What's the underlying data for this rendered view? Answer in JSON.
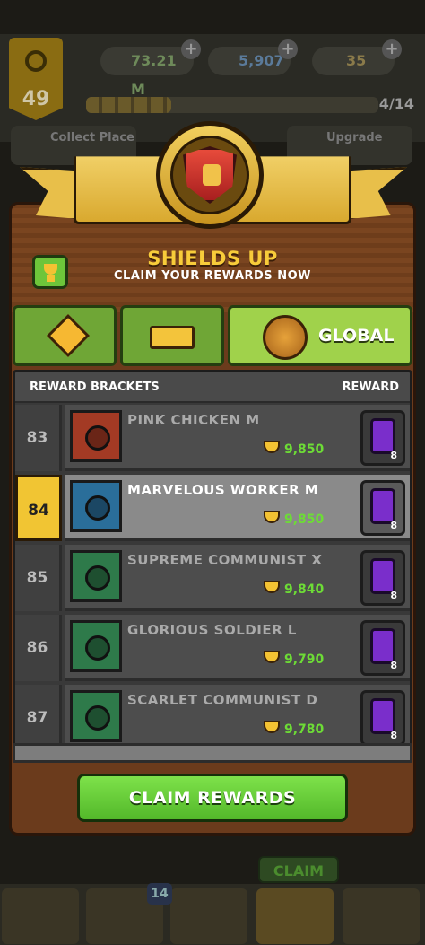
{
  "hud": {
    "level": "49",
    "cash": "73.21 M",
    "potions": "5,907",
    "tickets": "35",
    "xp_progress": "4/14",
    "left_button": "Collect Place",
    "right_button": "Upgrade",
    "claim_tag": "CLAIM",
    "notification_count": "14"
  },
  "modal": {
    "title": "SHIELDS UP",
    "subtitle": "CLAIM YOUR REWARDS NOW",
    "tabs": [
      {
        "label": "",
        "icon": "gem-icon"
      },
      {
        "label": "",
        "icon": "gold-block-icon"
      },
      {
        "label": "GLOBAL",
        "icon": "globe-laurel-icon",
        "active": true
      }
    ],
    "list_header": {
      "left": "REWARD BRACKETS",
      "right": "REWARD"
    },
    "rows": [
      {
        "rank": "83",
        "name": "PINK CHICKEN M",
        "score": "9,850",
        "reward_count": "8",
        "avatar": "bomb-icon",
        "avatar_bg": "#a33a24",
        "me": false
      },
      {
        "rank": "84",
        "name": "MARVELOUS WORKER M",
        "score": "9,850",
        "reward_count": "8",
        "avatar": "dino-skull-icon",
        "avatar_bg": "#2a6e9a",
        "me": true
      },
      {
        "rank": "85",
        "name": "SUPREME COMMUNIST X",
        "score": "9,840",
        "reward_count": "8",
        "avatar": "bomb-icon",
        "avatar_bg": "#2e7a4a",
        "me": false
      },
      {
        "rank": "86",
        "name": "GLORIOUS SOLDIER L",
        "score": "9,790",
        "reward_count": "8",
        "avatar": "cactus-icon",
        "avatar_bg": "#2e7a4a",
        "me": false
      },
      {
        "rank": "87",
        "name": "SCARLET COMMUNIST D",
        "score": "9,780",
        "reward_count": "8",
        "avatar": "cactus-icon",
        "avatar_bg": "#2e7a4a",
        "me": false
      }
    ],
    "claim_button": "CLAIM REWARDS"
  },
  "colors": {
    "accent_gold": "#f8cc3a",
    "score_green": "#6ddc36",
    "card_purple": "#7a2ecb",
    "button_green": "#6dd23c"
  }
}
